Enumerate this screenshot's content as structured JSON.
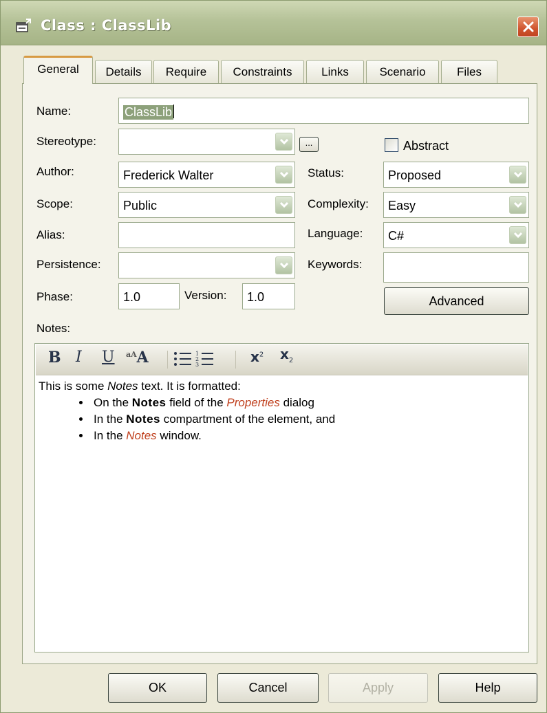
{
  "window": {
    "title": "Class : ClassLib"
  },
  "tabs": [
    {
      "label": "General"
    },
    {
      "label": "Details"
    },
    {
      "label": "Require"
    },
    {
      "label": "Constraints"
    },
    {
      "label": "Links"
    },
    {
      "label": "Scenario"
    },
    {
      "label": "Files"
    }
  ],
  "form": {
    "name_label": "Name:",
    "name_value": "ClassLib",
    "stereotype_label": "Stereotype:",
    "stereotype_value": "",
    "browse_label": "...",
    "abstract_label": "Abstract",
    "abstract_checked": false,
    "author_label": "Author:",
    "author_value": "Frederick Walter",
    "status_label": "Status:",
    "status_value": "Proposed",
    "scope_label": "Scope:",
    "scope_value": "Public",
    "complexity_label": "Complexity:",
    "complexity_value": "Easy",
    "alias_label": "Alias:",
    "alias_value": "",
    "language_label": "Language:",
    "language_value": "C#",
    "persistence_label": "Persistence:",
    "persistence_value": "",
    "keywords_label": "Keywords:",
    "keywords_value": "",
    "phase_label": "Phase:",
    "phase_value": "1.0",
    "version_label": "Version:",
    "version_value": "1.0",
    "advanced_label": "Advanced",
    "notes_label": "Notes:"
  },
  "notes": {
    "toolbar": {
      "bold": "B",
      "italic": "I",
      "underline": "U",
      "font": "A",
      "superscript": "x",
      "subscript": "x",
      "sup_digit": "2",
      "sub_digit": "2"
    },
    "intro_1": "This is some ",
    "intro_notes": "Notes",
    "intro_2": " text. It is formatted:",
    "b1_1": "On the ",
    "b1_bold": "Notes",
    "b1_2": " field of the ",
    "b1_ital": "Properties",
    "b1_3": " dialog",
    "b2_1": "In the ",
    "b2_bold": "Notes",
    "b2_2": " compartment of the element, and",
    "b3_1": "In the ",
    "b3_ital": "Notes",
    "b3_2": " window."
  },
  "buttons": {
    "ok": "OK",
    "cancel": "Cancel",
    "apply": "Apply",
    "help": "Help"
  },
  "colors": {
    "titlebar": "#b5c298",
    "dialog_bg": "#ecead8",
    "active_tab_accent": "#d79a42",
    "close_button": "#d0552f",
    "italic_accent": "#c0411f"
  }
}
